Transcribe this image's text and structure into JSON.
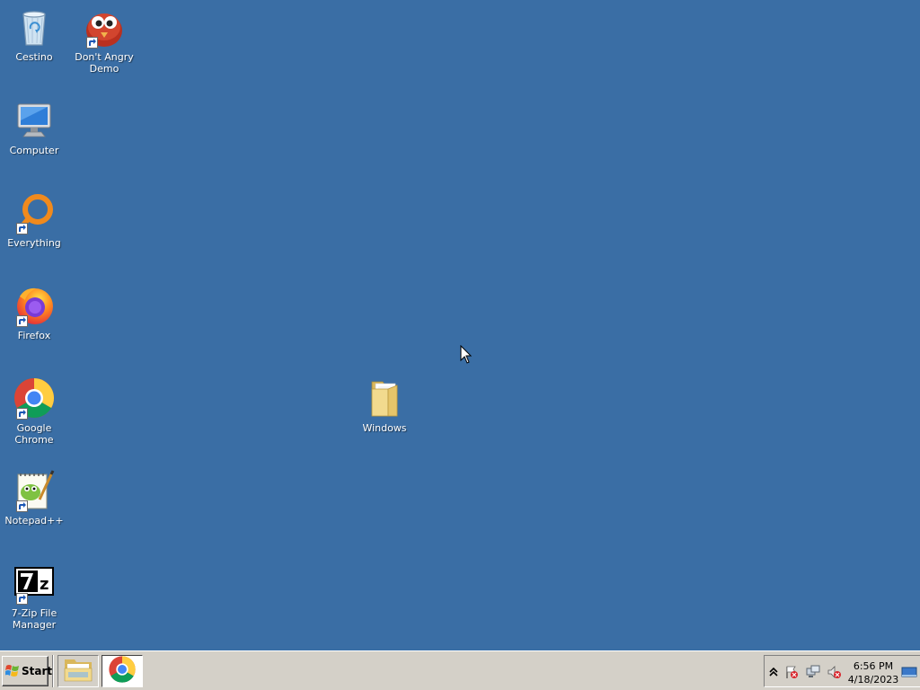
{
  "desktop": {
    "background": "#3a6ea5",
    "icons": [
      {
        "label": "Cestino",
        "icon": "recycle-bin-icon"
      },
      {
        "label": "Don't Angry Demo",
        "icon": "red-bird-icon"
      },
      {
        "label": "Computer",
        "icon": "computer-icon"
      },
      {
        "label": "Everything",
        "icon": "everything-search-icon"
      },
      {
        "label": "Firefox",
        "icon": "firefox-icon"
      },
      {
        "label": "Google Chrome",
        "icon": "chrome-icon"
      },
      {
        "label": "Notepad++",
        "icon": "notepadpp-icon"
      },
      {
        "label": "7-Zip File Manager",
        "icon": "sevenzip-icon"
      },
      {
        "label": "Windows",
        "icon": "folder-icon"
      }
    ]
  },
  "taskbar": {
    "start_label": "Start",
    "apps": [
      {
        "name": "Windows Explorer",
        "icon": "explorer-folder-icon"
      },
      {
        "name": "Google Chrome",
        "icon": "chrome-icon"
      }
    ],
    "tray": {
      "icons": [
        "show-hidden-icons-icon",
        "action-center-flag-icon",
        "network-icon",
        "volume-muted-icon",
        "show-desktop-icon"
      ],
      "time": "6:56 PM",
      "date": "4/18/2023"
    }
  }
}
